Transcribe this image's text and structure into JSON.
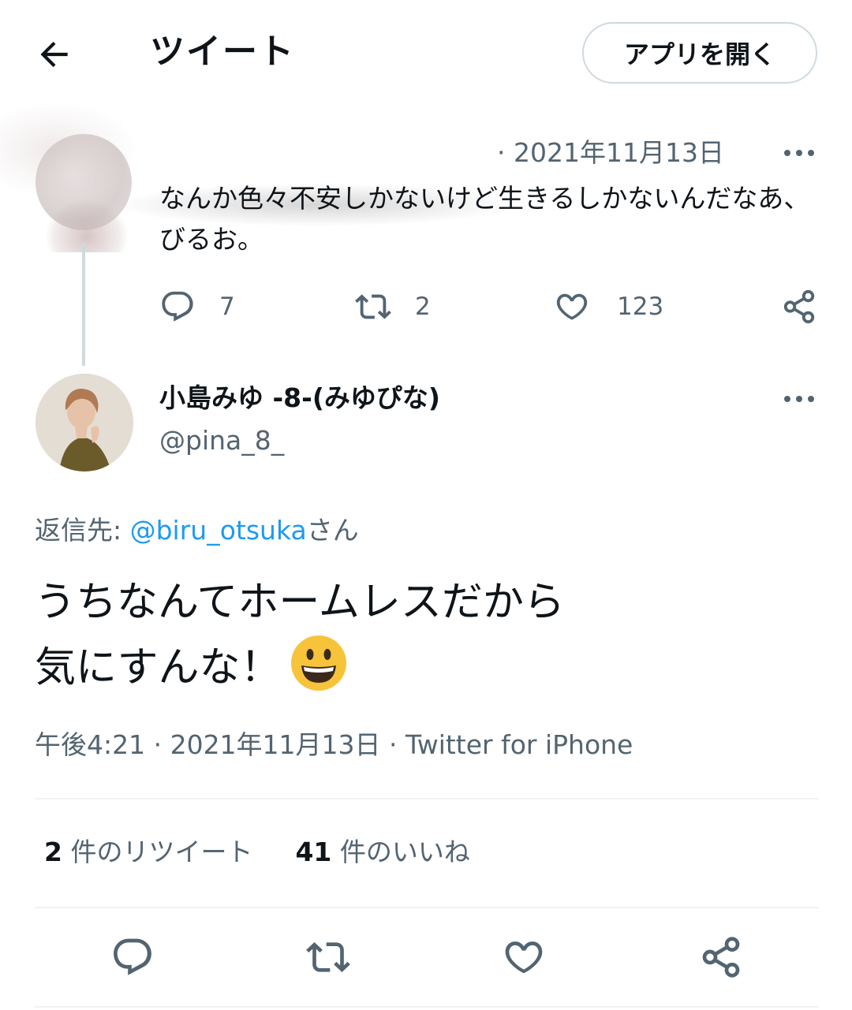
{
  "header": {
    "title": "ツイート",
    "open_app_label": "アプリを開く"
  },
  "parent_tweet": {
    "date": "· 2021年11月13日",
    "text": "なんか色々不安しかないけど生きるしかないんだなあ、びるお。",
    "reply_count": "7",
    "retweet_count": "2",
    "like_count": "123"
  },
  "tweet": {
    "display_name": "小島みゆ -8-(みゆぴな)",
    "handle": "@pina_8_",
    "reply_prefix": "返信先: ",
    "reply_mention": "@biru_otsuka",
    "reply_suffix": "さん",
    "text_line1": "うちなんてホームレスだから",
    "text_line2": "気にすんな！",
    "emoji": "grinning-face",
    "meta": "午後4:21 · 2021年11月13日 · Twitter for iPhone",
    "retweet_count": "2",
    "retweet_label": " 件のリツイート",
    "like_count": "41",
    "like_label": " 件のいいね"
  },
  "icons": {
    "back": "arrow-left-icon",
    "more": "more-dots-icon",
    "reply": "reply-bubble-icon",
    "retweet": "retweet-icon",
    "like": "heart-icon",
    "share": "share-icon"
  },
  "colors": {
    "text": "#0f1419",
    "secondary": "#536471",
    "link": "#1d9bf0",
    "border": "#cfd9de"
  }
}
